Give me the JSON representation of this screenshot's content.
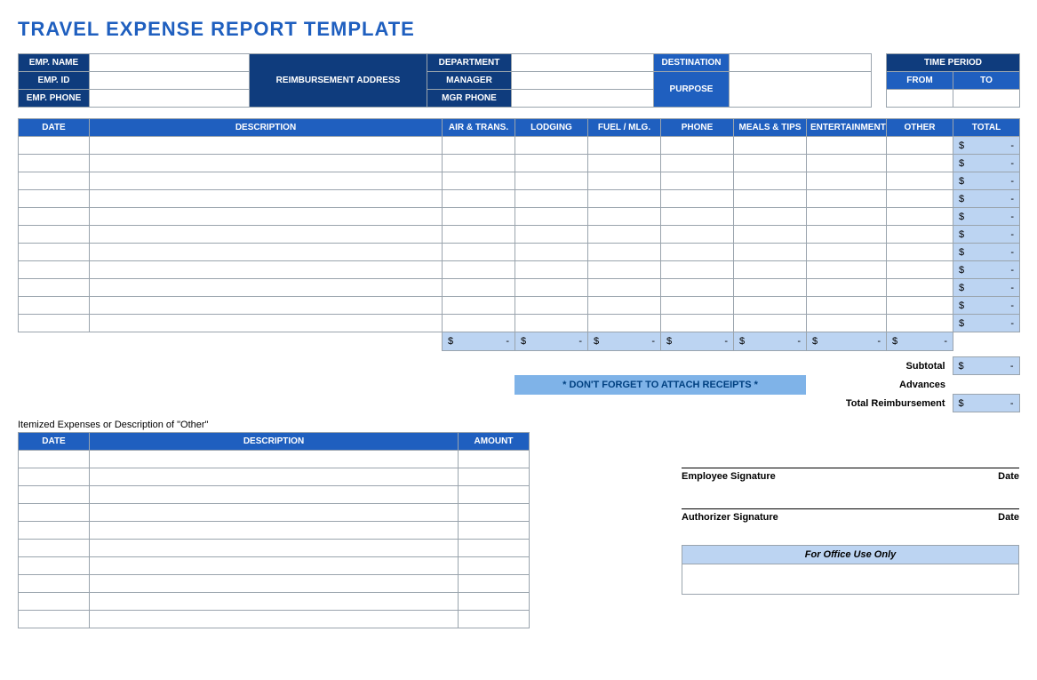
{
  "title": "TRAVEL EXPENSE REPORT TEMPLATE",
  "empInfo": {
    "nameLabel": "EMP. NAME",
    "idLabel": "EMP. ID",
    "phoneLabel": "EMP. PHONE",
    "reimbLabel": "REIMBURSEMENT ADDRESS",
    "deptLabel": "DEPARTMENT",
    "mgrLabel": "MANAGER",
    "mgrPhoneLabel": "MGR PHONE",
    "destLabel": "DESTINATION",
    "purposeLabel": "PURPOSE",
    "timePeriodLabel": "TIME PERIOD",
    "fromLabel": "FROM",
    "toLabel": "TO"
  },
  "expenseHeaders": {
    "date": "DATE",
    "desc": "DESCRIPTION",
    "air": "AIR & TRANS.",
    "lodging": "LODGING",
    "fuel": "FUEL / MLG.",
    "phone": "PHONE",
    "meals": "MEALS & TIPS",
    "ent": "ENTERTAINMENT",
    "other": "OTHER",
    "total": "TOTAL"
  },
  "rowTotal": {
    "currency": "$",
    "dash": "-"
  },
  "attachNote": "* DON'T FORGET TO ATTACH RECEIPTS *",
  "summary": {
    "subtotalLabel": "Subtotal",
    "advancesLabel": "Advances",
    "totalReimbLabel": "Total Reimbursement"
  },
  "itemized": {
    "caption": "Itemized Expenses or Description of \"Other\"",
    "date": "DATE",
    "desc": "DESCRIPTION",
    "amount": "AMOUNT"
  },
  "signatures": {
    "emp": "Employee Signature",
    "auth": "Authorizer Signature",
    "date": "Date"
  },
  "officeUse": "For Office Use Only"
}
